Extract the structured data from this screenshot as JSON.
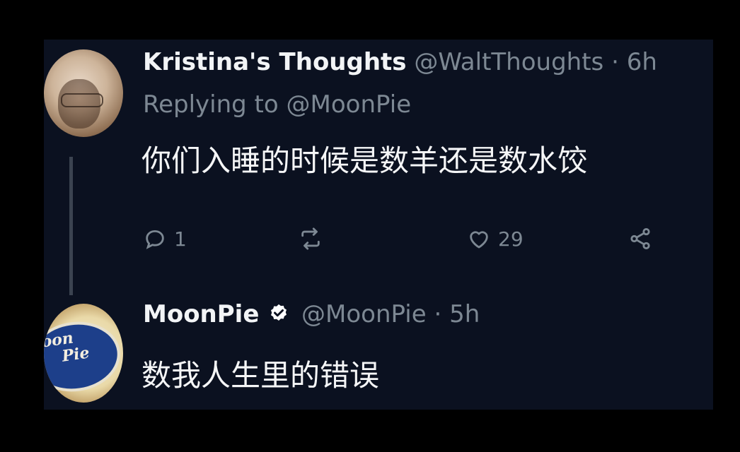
{
  "thread": [
    {
      "display_name": "Kristina's Thoughts",
      "handle": "@WaltThoughts",
      "separator": "·",
      "time": "6h",
      "replying_prefix": "Replying to",
      "replying_to": "@MoonPie",
      "text": "你们入睡的时候是数羊还是数水饺",
      "actions": {
        "reply_count": "1",
        "retweet_count": "",
        "like_count": "29"
      },
      "avatar_icon": "user-avatar-photo"
    },
    {
      "display_name": "MoonPie",
      "verified": true,
      "handle": "@MoonPie",
      "separator": "·",
      "time": "5h",
      "text": "数我人生里的错误",
      "avatar_icon": "moonpie-logo-avatar",
      "avatar_logo_text": [
        "oon",
        "Pie"
      ]
    }
  ],
  "colors": {
    "background": "#0b1120",
    "muted_text": "#7d8893",
    "primary_text": "#f5f6f7",
    "verified_badge": "#ffffff"
  }
}
